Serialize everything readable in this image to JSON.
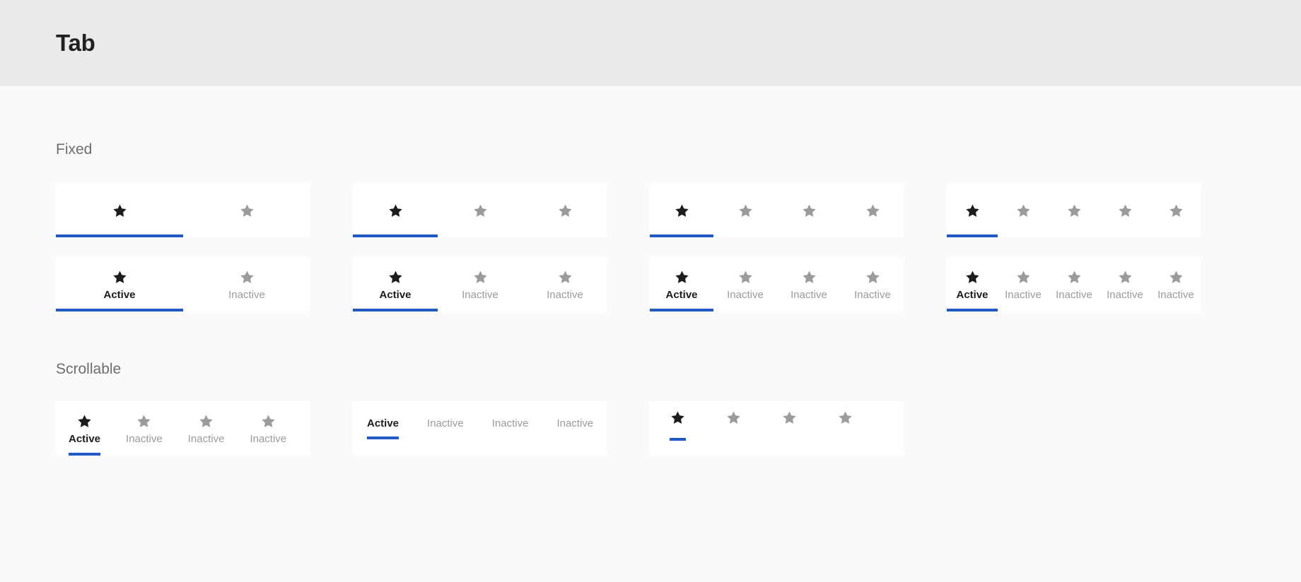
{
  "header": {
    "title": "Tab"
  },
  "colors": {
    "header_background": "#eaeaea",
    "page_background": "#fafafa",
    "card_background": "#ffffff",
    "active_indicator": "#1f59c5",
    "active_icon": "#1c1c1c",
    "active_label": "#1c1c1c",
    "inactive_icon": "#9b9b9b",
    "inactive_label": "#9b9b9b",
    "section_label": "#6d6d6d"
  },
  "sections": [
    {
      "id": "fixed",
      "label": "Fixed"
    },
    {
      "id": "scrollable",
      "label": "Scrollable"
    }
  ],
  "labels": {
    "active": "Active",
    "inactive": "Inactive"
  },
  "icons": {
    "star": "star-icon"
  },
  "fixed": {
    "row_icon_only": [
      {
        "id": "fixed-icon-2",
        "tab_count": 2,
        "tabs": [
          {
            "state": "active",
            "icon": "star-icon"
          },
          {
            "state": "inactive",
            "icon": "star-icon"
          }
        ]
      },
      {
        "id": "fixed-icon-3",
        "tab_count": 3,
        "tabs": [
          {
            "state": "active",
            "icon": "star-icon"
          },
          {
            "state": "inactive",
            "icon": "star-icon"
          },
          {
            "state": "inactive",
            "icon": "star-icon"
          }
        ]
      },
      {
        "id": "fixed-icon-4",
        "tab_count": 4,
        "tabs": [
          {
            "state": "active",
            "icon": "star-icon"
          },
          {
            "state": "inactive",
            "icon": "star-icon"
          },
          {
            "state": "inactive",
            "icon": "star-icon"
          },
          {
            "state": "inactive",
            "icon": "star-icon"
          }
        ]
      },
      {
        "id": "fixed-icon-5",
        "tab_count": 5,
        "tabs": [
          {
            "state": "active",
            "icon": "star-icon"
          },
          {
            "state": "inactive",
            "icon": "star-icon"
          },
          {
            "state": "inactive",
            "icon": "star-icon"
          },
          {
            "state": "inactive",
            "icon": "star-icon"
          },
          {
            "state": "inactive",
            "icon": "star-icon"
          }
        ]
      }
    ],
    "row_icon_and_label": [
      {
        "id": "fixed-both-2",
        "tab_count": 2,
        "tabs": [
          {
            "state": "active",
            "icon": "star-icon",
            "label": "Active"
          },
          {
            "state": "inactive",
            "icon": "star-icon",
            "label": "Inactive"
          }
        ]
      },
      {
        "id": "fixed-both-3",
        "tab_count": 3,
        "tabs": [
          {
            "state": "active",
            "icon": "star-icon",
            "label": "Active"
          },
          {
            "state": "inactive",
            "icon": "star-icon",
            "label": "Inactive"
          },
          {
            "state": "inactive",
            "icon": "star-icon",
            "label": "Inactive"
          }
        ]
      },
      {
        "id": "fixed-both-4",
        "tab_count": 4,
        "tabs": [
          {
            "state": "active",
            "icon": "star-icon",
            "label": "Active"
          },
          {
            "state": "inactive",
            "icon": "star-icon",
            "label": "Inactive"
          },
          {
            "state": "inactive",
            "icon": "star-icon",
            "label": "Inactive"
          },
          {
            "state": "inactive",
            "icon": "star-icon",
            "label": "Inactive"
          }
        ]
      },
      {
        "id": "fixed-both-5",
        "tab_count": 5,
        "tabs": [
          {
            "state": "active",
            "icon": "star-icon",
            "label": "Active"
          },
          {
            "state": "inactive",
            "icon": "star-icon",
            "label": "Inactive"
          },
          {
            "state": "inactive",
            "icon": "star-icon",
            "label": "Inactive"
          },
          {
            "state": "inactive",
            "icon": "star-icon",
            "label": "Inactive"
          },
          {
            "state": "inactive",
            "icon": "star-icon",
            "label": "Inactive"
          }
        ]
      }
    ]
  },
  "scrollable": {
    "cards": [
      {
        "id": "scroll-icon-label",
        "variant": "icon-and-label",
        "tabs": [
          {
            "state": "active",
            "icon": "star-icon",
            "label": "Active"
          },
          {
            "state": "inactive",
            "icon": "star-icon",
            "label": "Inactive"
          },
          {
            "state": "inactive",
            "icon": "star-icon",
            "label": "Inactive"
          },
          {
            "state": "inactive",
            "icon": "star-icon",
            "label": "Inactive"
          }
        ]
      },
      {
        "id": "scroll-label-only",
        "variant": "label-only",
        "tabs": [
          {
            "state": "active",
            "label": "Active"
          },
          {
            "state": "inactive",
            "label": "Inactive"
          },
          {
            "state": "inactive",
            "label": "Inactive"
          },
          {
            "state": "inactive",
            "label": "Inactive"
          }
        ]
      },
      {
        "id": "scroll-icon-only",
        "variant": "icon-only",
        "tabs": [
          {
            "state": "active",
            "icon": "star-icon"
          },
          {
            "state": "inactive",
            "icon": "star-icon"
          },
          {
            "state": "inactive",
            "icon": "star-icon"
          },
          {
            "state": "inactive",
            "icon": "star-icon"
          }
        ]
      }
    ]
  }
}
